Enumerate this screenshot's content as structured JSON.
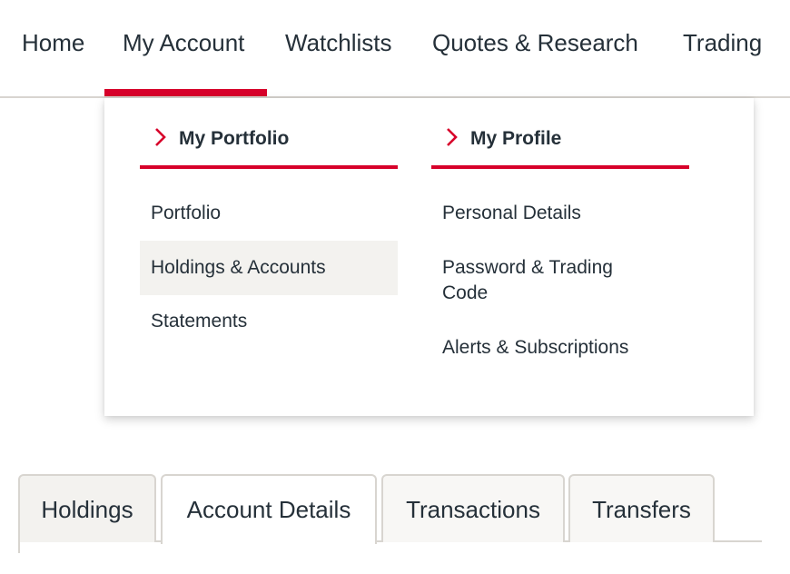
{
  "top_nav": {
    "items": [
      {
        "label": "Home",
        "active": false
      },
      {
        "label": "My Account",
        "active": true
      },
      {
        "label": "Watchlists",
        "active": false
      },
      {
        "label": "Quotes & Research",
        "active": false
      },
      {
        "label": "Trading",
        "active": false
      }
    ]
  },
  "dropdown": {
    "columns": [
      {
        "title": "My Portfolio",
        "icon": "chevron-right-icon",
        "items": [
          {
            "label": "Portfolio",
            "highlighted": false
          },
          {
            "label": "Holdings & Accounts",
            "highlighted": true
          },
          {
            "label": "Statements",
            "highlighted": false
          }
        ]
      },
      {
        "title": "My Profile",
        "icon": "chevron-right-icon",
        "items": [
          {
            "label": "Personal Details",
            "highlighted": false
          },
          {
            "label": "Password & Trading Code",
            "highlighted": false
          },
          {
            "label": "Alerts & Subscriptions",
            "highlighted": false
          }
        ]
      }
    ]
  },
  "tabs": {
    "items": [
      {
        "label": "Holdings",
        "selected": false
      },
      {
        "label": "Account Details",
        "selected": true
      },
      {
        "label": "Transactions",
        "selected": false
      },
      {
        "label": "Transfers",
        "selected": false
      }
    ]
  },
  "colors": {
    "accent": "#d7002a",
    "text": "#253039",
    "hover_bg": "#f3f2ef",
    "border": "#d8d5d0"
  }
}
